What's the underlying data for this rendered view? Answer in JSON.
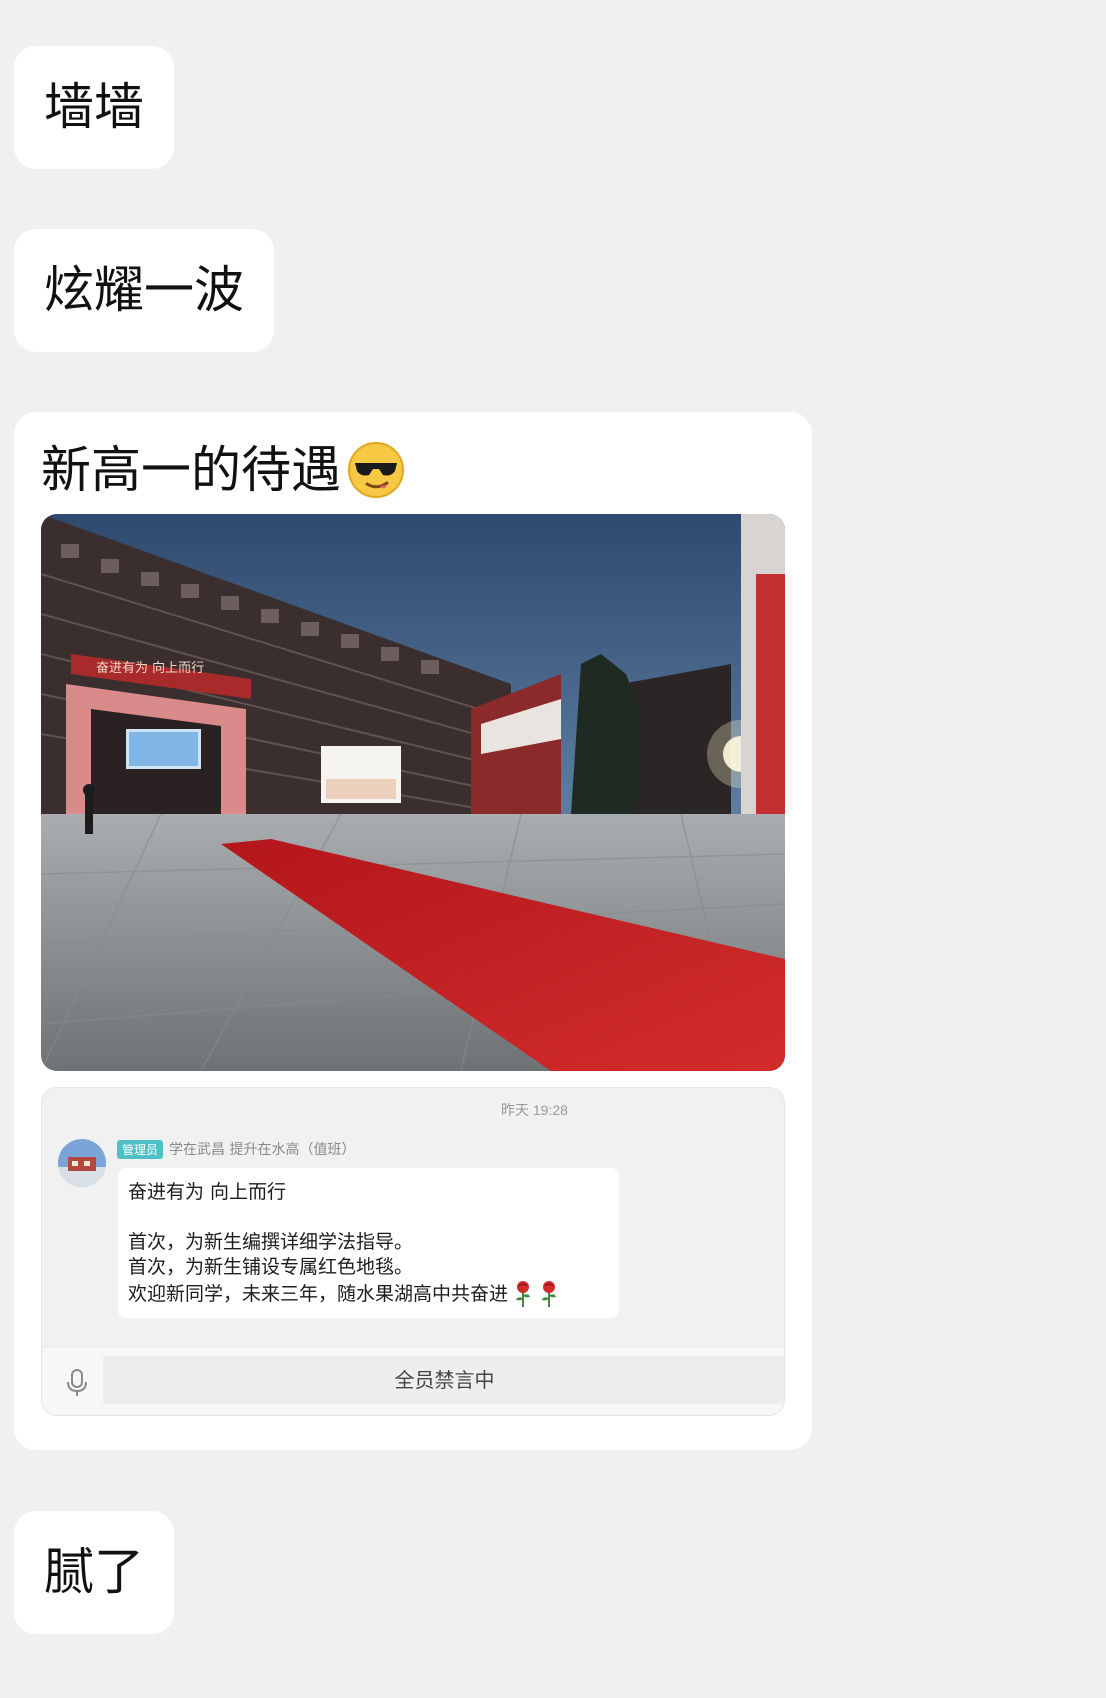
{
  "messages": [
    {
      "text": "墙墙"
    },
    {
      "text": "炫耀一波"
    },
    {
      "text": "新高一的待遇",
      "emoji": "cool-sunglasses-emoji",
      "photo": {
        "banner_text": "奋进有为 向上而行"
      },
      "embedded_screenshot": {
        "time": "昨天 19:28",
        "badge": "管理员",
        "sender": "学在武昌 提升在水高（值班）",
        "message_lines": [
          "奋进有为 向上而行",
          "",
          "首次，为新生编撰详细学法指导。",
          "首次，为新生铺设专属红色地毯。",
          "欢迎新同学，未来三年，随水果湖高中共奋进"
        ],
        "trailing_icons": [
          "rose-icon",
          "rose-icon"
        ],
        "input_status": "全员禁言中"
      }
    },
    {
      "text": "腻了"
    }
  ],
  "colors": {
    "background": "#f0f0f0",
    "bubble": "#ffffff",
    "badge": "#4fc1c6",
    "carpet": "#d42a2a"
  }
}
